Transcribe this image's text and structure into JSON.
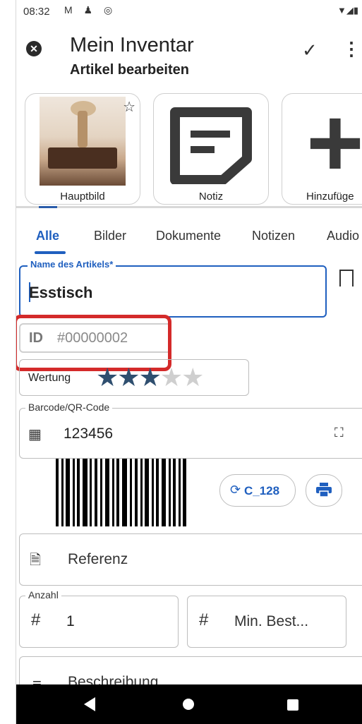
{
  "status_bar": {
    "time": "08:32",
    "left_icons": "M ♟ ◎",
    "right_icons": "▼◢▮"
  },
  "appbar": {
    "title": "Mein Inventar",
    "subtitle": "Artikel bearbeiten"
  },
  "thumbnails": [
    {
      "label": "Hauptbild"
    },
    {
      "label": "Notiz"
    },
    {
      "label": "Hinzufüge"
    }
  ],
  "tabs": [
    "Alle",
    "Bilder",
    "Dokumente",
    "Notizen",
    "Audio"
  ],
  "name_field": {
    "label": "Name des Artikels*",
    "value": "Esstisch"
  },
  "id_field": {
    "key": "ID",
    "value": "#00000002"
  },
  "rating": {
    "label": "Wertung",
    "value": 3,
    "max": 5
  },
  "barcode": {
    "label": "Barcode/QR-Code",
    "value": "123456",
    "format": "C_128"
  },
  "reference": {
    "placeholder": "Referenz"
  },
  "quantity": {
    "label": "Anzahl",
    "value": "1"
  },
  "min_stock": {
    "placeholder": "Min. Best..."
  },
  "description": {
    "placeholder": "Beschreibung"
  },
  "colors": {
    "accent": "#1f5fbf",
    "highlight": "#d42a2a",
    "star_on": "#2f4f6f"
  }
}
